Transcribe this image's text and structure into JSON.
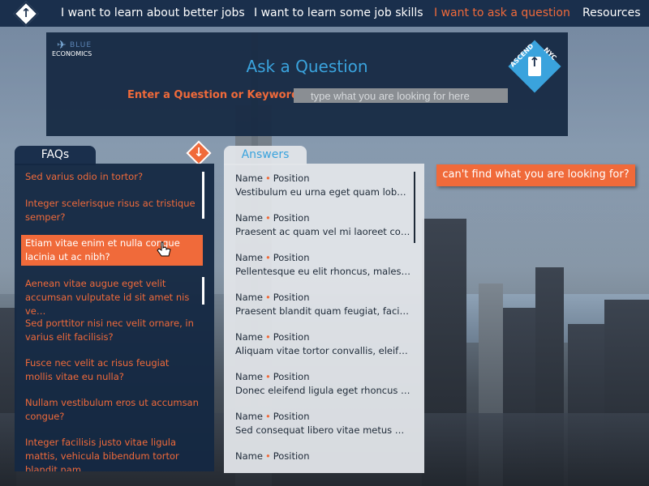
{
  "nav": {
    "items": [
      {
        "label": "I want to learn about better jobs",
        "active": false
      },
      {
        "label": "I want to learn some job skills",
        "active": false
      },
      {
        "label": "I want to ask a question",
        "active": true
      },
      {
        "label": "Resources",
        "active": false
      }
    ]
  },
  "ask": {
    "logo_text": "ECONOMICS",
    "logo_small": "BLUE",
    "title": "Ask a Question",
    "label": "Enter a Question or Keyword:",
    "placeholder": "type what you are looking for here",
    "badge_left": "ASCEND",
    "badge_right": "NYC"
  },
  "faq": {
    "tab_label": "FAQs",
    "items": [
      "Sed varius odio in tortor?",
      "Integer scelerisque risus ac tristique semper?",
      "Etiam vitae enim et nulla congue lacinia ut ac nibh?",
      "Aenean vitae augue eget velit accumsan vulputate id sit amet nis ve…",
      "Sed porttitor nisi nec velit ornare, in varius elit facilisis?",
      "Fusce nec velit ac risus feugiat mollis vitae eu nulla?",
      "Nullam vestibulum eros ut accumsan congue?",
      "Integer facilisis justo vitae ligula mattis, vehicula bibendum tortor blandit nam…"
    ],
    "selected_index": 2
  },
  "answers": {
    "tab_label": "Answers",
    "name_label": "Name",
    "position_label": "Position",
    "items": [
      "Vestibulum eu urna eget quam lobor…",
      "Praesent ac quam vel mi laoreet con…",
      "Pellentesque eu elit rhoncus, malesu…",
      "Praesent blandit quam feugiat, facili…",
      "Aliquam vitae tortor convallis, eleif…",
      "Donec eleifend ligula eget rhoncus u…",
      "Sed consequat libero vitae metus m…",
      ""
    ]
  },
  "cant_find": "can't find what you are looking for?",
  "colors": {
    "navy": "#1a2f4c",
    "accent_orange": "#f06a3a",
    "accent_blue": "#3aa3dd"
  }
}
